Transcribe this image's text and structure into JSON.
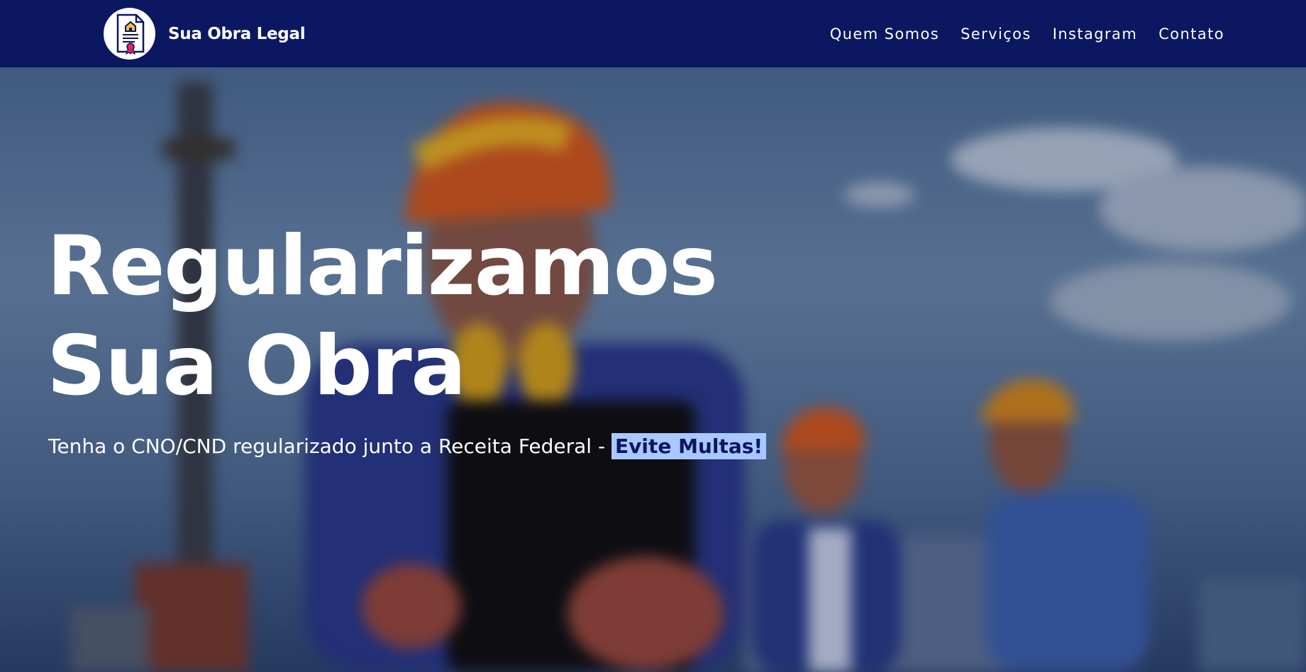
{
  "brand": {
    "name": "Sua Obra Legal",
    "logo_icon": "certificate-icon"
  },
  "nav": {
    "items": [
      {
        "label": "Quem Somos"
      },
      {
        "label": "Serviços"
      },
      {
        "label": "Instagram"
      },
      {
        "label": "Contato"
      }
    ]
  },
  "hero": {
    "headline_line1": "Regularizamos",
    "headline_line2": "Sua Obra",
    "subtitle": "Tenha o CNO/CND regularizado junto a Receita Federal - ",
    "highlight": "Evite Multas!"
  },
  "colors": {
    "navbar": "#0b1761",
    "highlight_bg": "#a9c8ff",
    "highlight_text": "#0b1761"
  }
}
